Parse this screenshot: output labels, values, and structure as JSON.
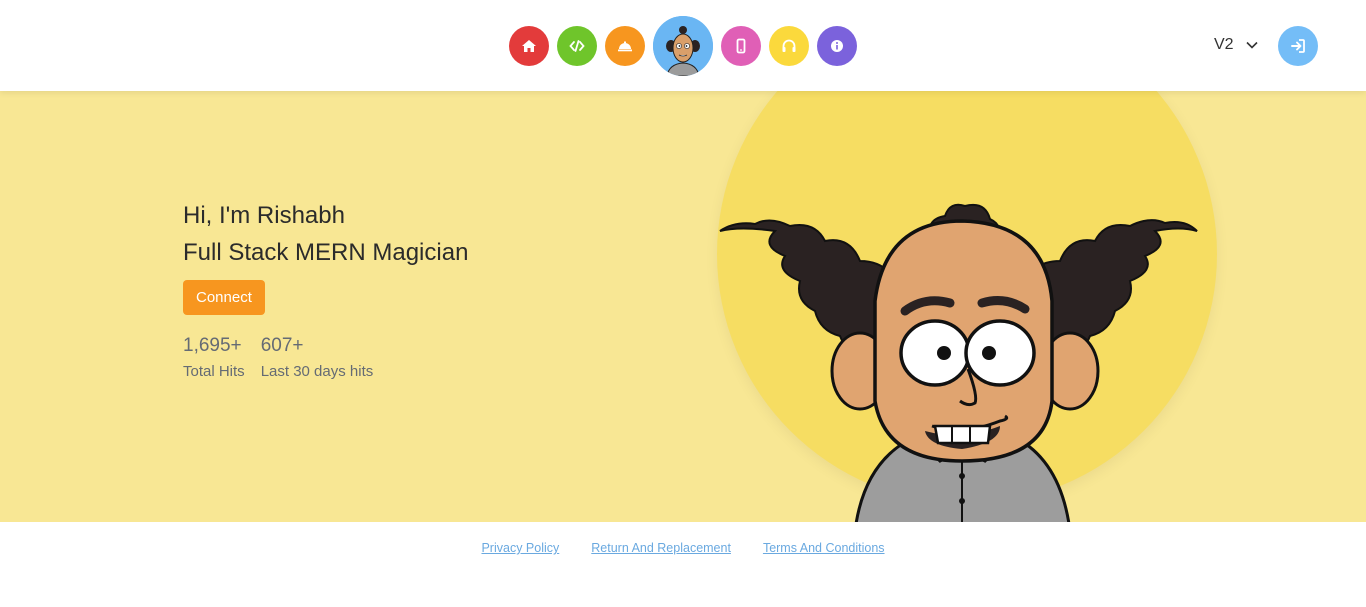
{
  "nav": {
    "icons": [
      {
        "name": "home-icon",
        "color": "#e33b3b"
      },
      {
        "name": "code-icon",
        "color": "#6fc52b"
      },
      {
        "name": "service-bell-icon",
        "color": "#f7961f"
      },
      {
        "name": "avatar",
        "color": "#6ab6f3"
      },
      {
        "name": "mobile-icon",
        "color": "#e05fb6"
      },
      {
        "name": "headphones-icon",
        "color": "#fbd93c"
      },
      {
        "name": "info-icon",
        "color": "#7b62dc"
      }
    ],
    "version": "V2",
    "login_icon": "sign-in-icon"
  },
  "hero": {
    "greeting": "Hi, I'm Rishabh",
    "role": "Full Stack MERN Magician",
    "connect_label": "Connect",
    "stats": [
      {
        "value": "1,695+",
        "label": "Total Hits"
      },
      {
        "value": "607+",
        "label": "Last 30 days hits"
      }
    ],
    "background_color": "#f8e794",
    "circle_color": "#f6dd62"
  },
  "footer": {
    "links": [
      "Privacy Policy",
      "Return And Replacement",
      "Terms And Conditions"
    ]
  }
}
